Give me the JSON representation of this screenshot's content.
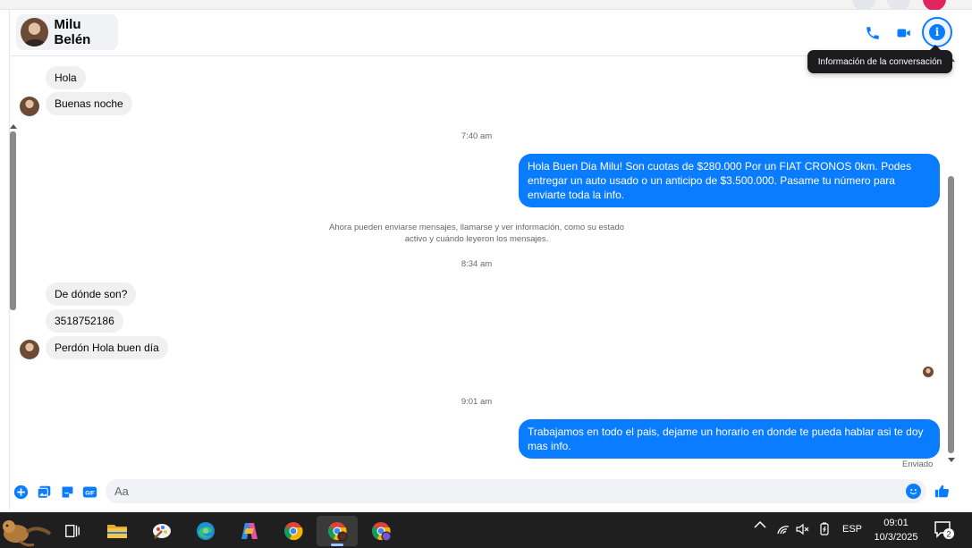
{
  "header": {
    "contact_name": "Milu Belén",
    "tooltip": "Información de la conversación"
  },
  "messages": [
    {
      "dir": "in",
      "text": "Hola"
    },
    {
      "dir": "in",
      "text": "Buenas noche"
    },
    {
      "time": "7:40 am"
    },
    {
      "dir": "out",
      "text": "Hola Buen Dia Milu! Son cuotas de $280.000 Por un FIAT CRONOS 0km. Podes entregar un auto usado o un anticipo de $3.500.000. Pasame tu número para enviarte toda la info."
    },
    {
      "system": "Ahora pueden enviarse mensajes, llamarse y ver información, como su estado activo y cuándo leyeron los mensajes."
    },
    {
      "time": "8:34 am"
    },
    {
      "dir": "in",
      "text": "De dónde son?"
    },
    {
      "dir": "in",
      "text": "3518752186"
    },
    {
      "dir": "in",
      "text": "Perdón Hola buen día"
    },
    {
      "time": "9:01 am"
    },
    {
      "dir": "out",
      "text": "Trabajamos en todo el pais, dejame un horario en donde te pueda hablar asi te doy mas info."
    }
  ],
  "status": {
    "sent": "Enviado"
  },
  "composer": {
    "placeholder": "Aa",
    "gif_label": "GIF"
  },
  "taskbar": {
    "language": "ESP",
    "time": "09:01",
    "date": "10/3/2025",
    "notification_count": "2"
  },
  "colors": {
    "accent": "#0a7cff",
    "incoming_bubble": "#f0f0f0",
    "taskbar": "#1f1f1f"
  }
}
